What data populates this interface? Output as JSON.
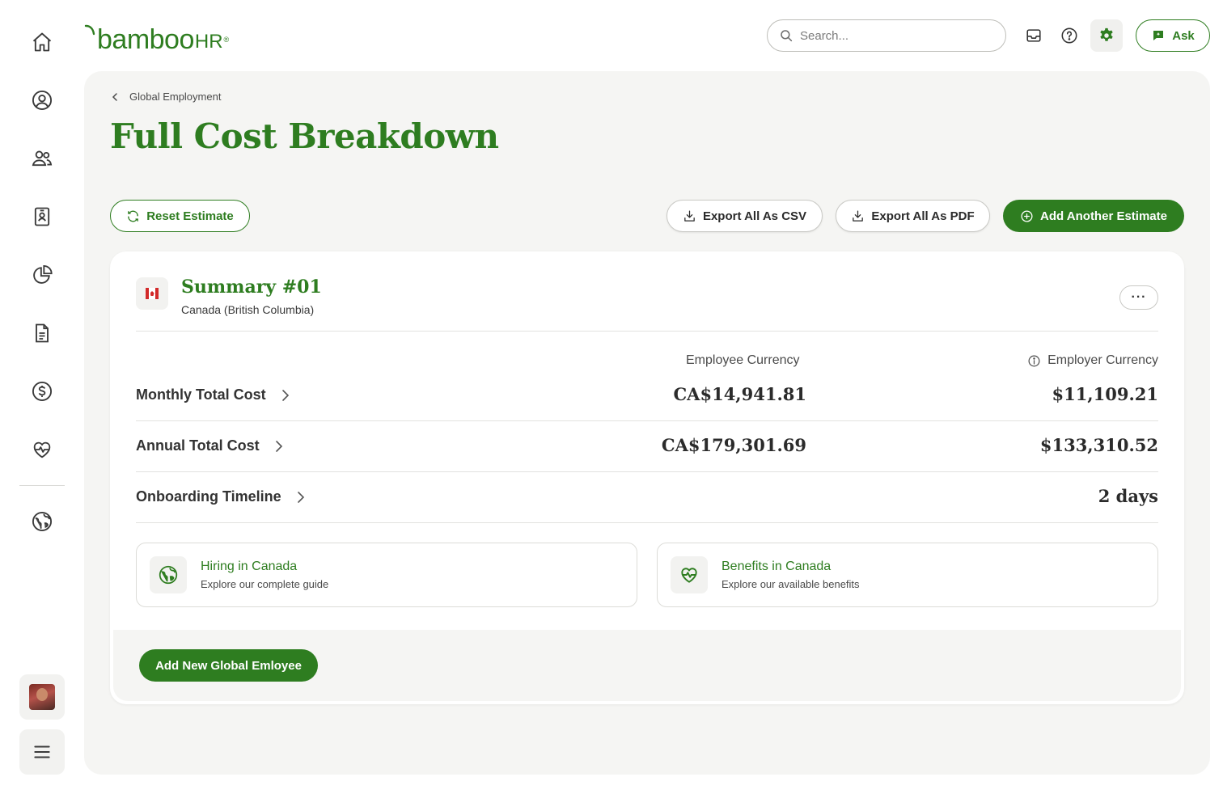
{
  "app": {
    "brand_main": "bamboo",
    "brand_suffix": "HR",
    "brand_reg": "®"
  },
  "header": {
    "search_placeholder": "Search...",
    "ask_label": "Ask"
  },
  "breadcrumb": {
    "label": "Global Employment"
  },
  "page": {
    "title": "Full Cost Breakdown"
  },
  "toolbar": {
    "reset_label": "Reset Estimate",
    "export_csv_label": "Export All As CSV",
    "export_pdf_label": "Export All As PDF",
    "add_estimate_label": "Add Another Estimate"
  },
  "summary": {
    "title": "Summary #01",
    "location": "Canada (British Columbia)",
    "more_label": "···",
    "columns": {
      "employee": "Employee Currency",
      "employer": "Employer Currency"
    },
    "rows": [
      {
        "label": "Monthly Total Cost",
        "employee": "CA$14,941.81",
        "employer": "$11,109.21"
      },
      {
        "label": "Annual Total Cost",
        "employee": "CA$179,301.69",
        "employer": "$133,310.52"
      },
      {
        "label": "Onboarding Timeline",
        "employee": "",
        "employer": "2 days"
      }
    ],
    "guides": [
      {
        "title": "Hiring in Canada",
        "subtitle": "Explore our complete guide",
        "icon": "globe-icon"
      },
      {
        "title": "Benefits in Canada",
        "subtitle": "Explore our available benefits",
        "icon": "heart-pulse-icon"
      }
    ],
    "footer_button": "Add New Global Emloyee"
  },
  "colors": {
    "brand_green": "#2e7d20",
    "panel_bg": "#f5f5f3",
    "flag_red": "#d22a2a"
  }
}
